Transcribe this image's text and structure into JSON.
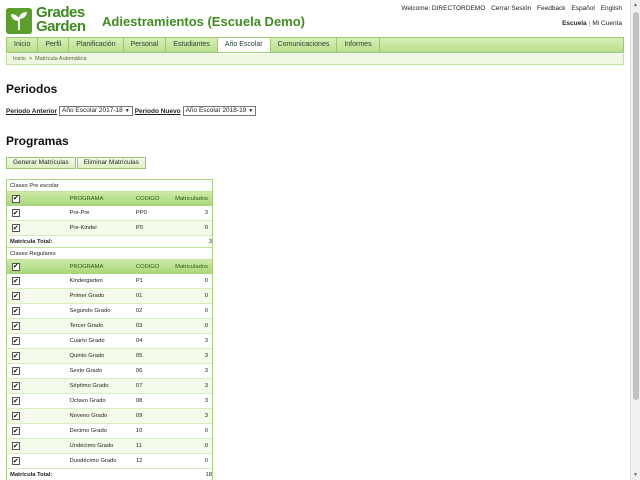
{
  "header": {
    "logo_line1": "Grades",
    "logo_line2": "Garden",
    "title": "Adiestramientos (Escuela Demo)",
    "welcome": "Welcome: DIRECTORDEMO",
    "links": [
      "Cerrar Sesión",
      "Feedback",
      "Español",
      "English"
    ],
    "sub_active": "Escuela",
    "sub_link": "Mi Cuenta"
  },
  "nav": {
    "tabs": [
      "Inicio",
      "Perfil",
      "Planificación",
      "Personal",
      "Estudiantes",
      "Año Escolar",
      "Comunicaciones",
      "Informes"
    ],
    "active": "Año Escolar"
  },
  "breadcrumb": [
    "Inicio",
    "Matrícula Automática"
  ],
  "periodos": {
    "heading": "Periodos",
    "anterior_label": "Periodo Anterior",
    "anterior_value": "Año Escolar 2017-18",
    "nuevo_label": "Periodo Nuevo",
    "nuevo_value": "Año Escolar 2018-19"
  },
  "programas": {
    "heading": "Programas",
    "btn_generar": "Generar Matrículas",
    "btn_eliminar": "Eliminar Matrículas"
  },
  "table": {
    "columns": [
      "PROGRAMA",
      "CODIGO",
      "Matriculados"
    ],
    "total_label": "Matrícula Total:",
    "groups": [
      {
        "title": "Clases Pre escolar",
        "rows": [
          {
            "programa": "Pre-Pre",
            "codigo": "PP0",
            "matriculados": "3"
          },
          {
            "programa": "Pre-Kinder",
            "codigo": "P0",
            "matriculados": "0"
          }
        ],
        "total": "3"
      },
      {
        "title": "Clases Regulares",
        "rows": [
          {
            "programa": "Kindergarten",
            "codigo": "P1",
            "matriculados": "0"
          },
          {
            "programa": "Primer Grado",
            "codigo": "01",
            "matriculados": "0"
          },
          {
            "programa": "Segundo Grado",
            "codigo": "02",
            "matriculados": "0"
          },
          {
            "programa": "Tercer Grado",
            "codigo": "03",
            "matriculados": "0"
          },
          {
            "programa": "Cuarto Grado",
            "codigo": "04",
            "matriculados": "3"
          },
          {
            "programa": "Quinto Grado",
            "codigo": "05",
            "matriculados": "3"
          },
          {
            "programa": "Sexto Grado",
            "codigo": "06",
            "matriculados": "3"
          },
          {
            "programa": "Séptimo Grado",
            "codigo": "07",
            "matriculados": "3"
          },
          {
            "programa": "Octavo Grado",
            "codigo": "08",
            "matriculados": "3"
          },
          {
            "programa": "Noveno Grado",
            "codigo": "09",
            "matriculados": "3"
          },
          {
            "programa": "Decimo Grado",
            "codigo": "10",
            "matriculados": "0"
          },
          {
            "programa": "Undécimo Grado",
            "codigo": "11",
            "matriculados": "0"
          },
          {
            "programa": "Duodécimo Grado",
            "codigo": "12",
            "matriculados": "0"
          }
        ],
        "total": "18"
      }
    ]
  },
  "colors": {
    "brand_green": "#3f8d20",
    "nav_bg": "#c6e6a0",
    "header_row": "#a9d77c"
  }
}
